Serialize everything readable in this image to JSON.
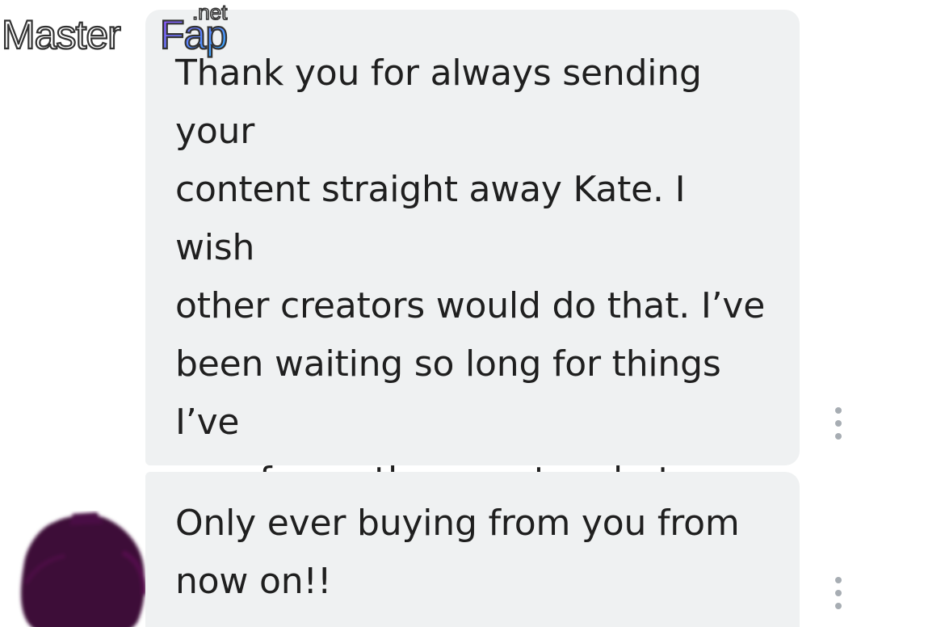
{
  "messages": [
    {
      "text": "Thank you for always sending your\ncontent straight away Kate. I wish\nother creators would do that. I’ve\nbeen waiting so long for things I’ve\nwon from other creators but you\nalways send straight away so\nthanks",
      "menu_icon": "vertical-ellipsis-icon"
    },
    {
      "text": "Only ever buying from you from\nnow on!!",
      "menu_icon": "vertical-ellipsis-icon"
    }
  ],
  "avatar": {
    "color": "#3d0838",
    "style": "scribbled-out"
  },
  "watermark": {
    "brand": "MasterFap",
    "suffix": ".net",
    "gradient": [
      "#9b4dff",
      "#2ab3ff"
    ]
  },
  "colors": {
    "bubble_background": "#eff1f2",
    "text": "#1f1f1f",
    "menu_dots": "#a7adb3"
  }
}
